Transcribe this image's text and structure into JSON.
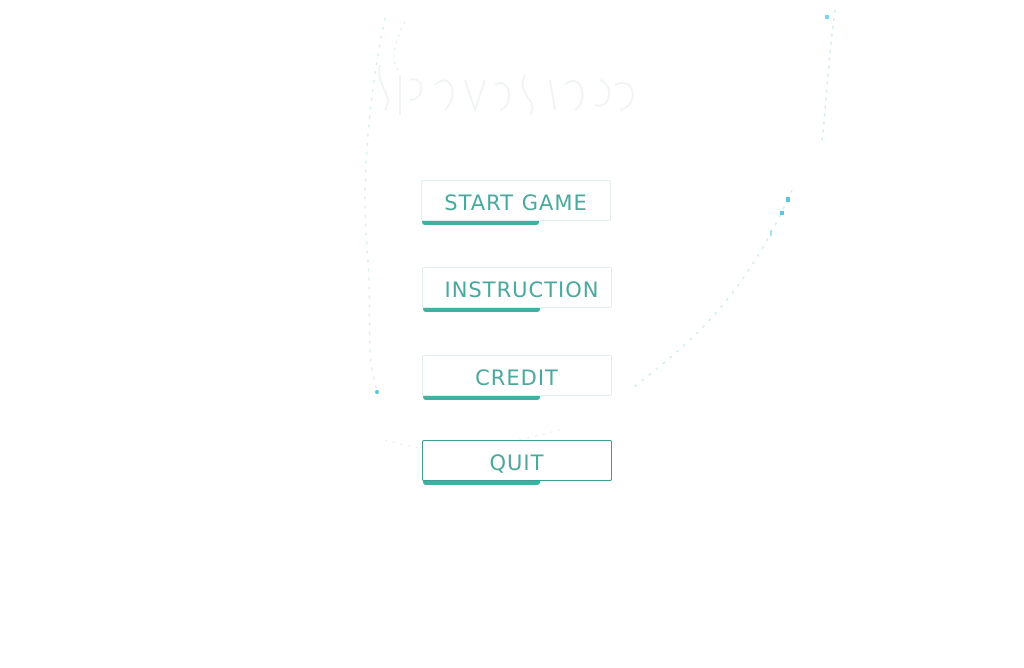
{
  "menu": {
    "start_label": "START GAME",
    "instruction_label": "INSTRUCTION",
    "credit_label": "CREDIT",
    "quit_label": "QUIT"
  },
  "colors": {
    "button_text": "#4aa89c",
    "underline": "#3fb0a2",
    "splash_accent": "#5bc6e0",
    "background": "#ffffff"
  }
}
